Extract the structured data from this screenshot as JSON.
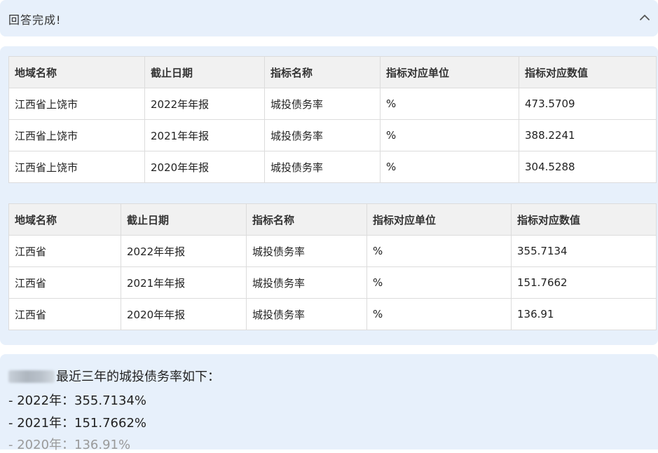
{
  "header": {
    "title": "回答完成!",
    "collapse_icon": "chevron-up-icon"
  },
  "tables": [
    {
      "columns": [
        "地域名称",
        "截止日期",
        "指标名称",
        "指标对应单位",
        "指标对应数值"
      ],
      "rows": [
        [
          "江西省上饶市",
          "2022年年报",
          "城投债务率",
          "%",
          "473.5709"
        ],
        [
          "江西省上饶市",
          "2021年年报",
          "城投债务率",
          "%",
          "388.2241"
        ],
        [
          "江西省上饶市",
          "2020年年报",
          "城投债务率",
          "%",
          "304.5288"
        ]
      ]
    },
    {
      "columns": [
        "地域名称",
        "截止日期",
        "指标名称",
        "指标对应单位",
        "指标对应数值"
      ],
      "rows": [
        [
          "江西省",
          "2022年年报",
          "城投债务率",
          "%",
          "355.7134"
        ],
        [
          "江西省",
          "2021年年报",
          "城投债务率",
          "%",
          "151.7662"
        ],
        [
          "江西省",
          "2020年年报",
          "城投债务率",
          "%",
          "136.91"
        ]
      ]
    }
  ],
  "summary": {
    "intro": "最近三年的城投债务率如下：",
    "lines": [
      "- 2022年：355.7134%",
      "- 2021年：151.7662%",
      "- 2020年：136.91%"
    ]
  },
  "colors": {
    "panel_bg": "#e7f0fb",
    "table_header_bg": "#f1f1f1",
    "border": "#dcdcdc"
  }
}
